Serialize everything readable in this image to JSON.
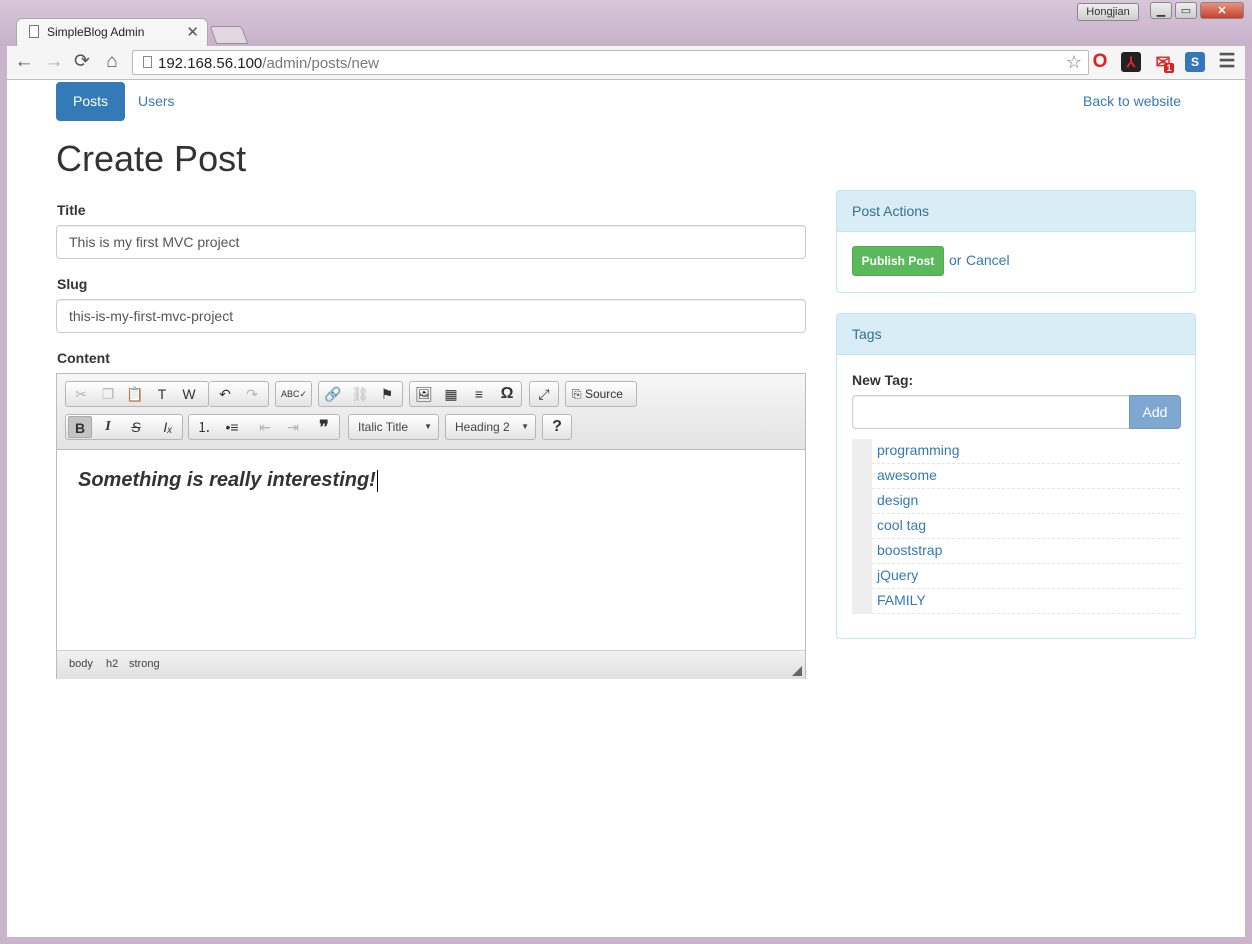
{
  "window": {
    "tab_title": "SimpleBlog Admin",
    "tab_close": "✕",
    "user_badge": "Hongjian",
    "min_icon": "▁",
    "max_icon": "▭",
    "close_icon": "✕"
  },
  "toolbar": {
    "back_icon": "←",
    "forward_icon": "→",
    "reload_icon": "⟳",
    "home_icon": "⌂",
    "url_host": "192.168.56.100",
    "url_path": "/admin/posts/new",
    "star_icon": "☆",
    "ext_opera": "O",
    "ext_pdf": "⅄",
    "ext_mail": "✉",
    "ext_mail_count": "1",
    "ext_s": "S",
    "menu_icon": "☰"
  },
  "nav": {
    "posts": "Posts",
    "users": "Users",
    "back_to_website": "Back to website"
  },
  "page_title": "Create Post",
  "form": {
    "title_label": "Title",
    "title_value": "This is my first MVC project",
    "slug_label": "Slug",
    "slug_value": "this-is-my-first-mvc-project",
    "content_label": "Content"
  },
  "editor": {
    "icons": {
      "cut": "✂",
      "copy": "❐",
      "paste": "📋",
      "paste_text": "T",
      "paste_word": "W",
      "undo": "↶",
      "redo": "↷",
      "spellcheck": "ABC✓",
      "link": "🔗",
      "unlink": "⛓",
      "anchor": "⚑",
      "image": "🖼",
      "table": "▦",
      "hr": "≡",
      "special_char": "Ω",
      "maximize": "⤢",
      "source_icon": "⎘",
      "bold": "B",
      "italic": "I",
      "strike": "S",
      "remove_format": "Iₓ",
      "numbered_list": "⒈",
      "bulleted_list": "•≡",
      "outdent": "⇤",
      "indent": "⇥",
      "blockquote": "❞",
      "help": "?",
      "dropdown_arrow": "▼"
    },
    "source_label": "Source",
    "style_combo": "Italic Title",
    "format_combo": "Heading 2",
    "content_text": "Something is really interesting!",
    "path": [
      "body",
      "h2",
      "strong"
    ]
  },
  "post_actions": {
    "heading": "Post Actions",
    "publish": "Publish Post",
    "or": "or",
    "cancel": "Cancel"
  },
  "tags": {
    "heading": "Tags",
    "new_tag_label": "New Tag:",
    "new_tag_value": "",
    "add": "Add",
    "items": [
      "programming",
      "awesome",
      "design",
      "cool tag",
      "booststrap",
      "jQuery",
      "FAMILY"
    ]
  }
}
